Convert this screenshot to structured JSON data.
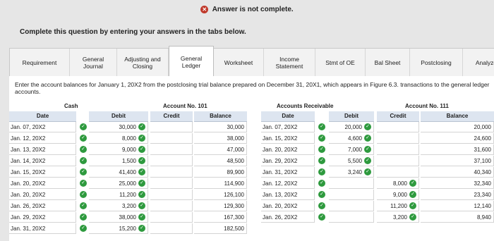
{
  "status": {
    "icon": "error-icon",
    "text": "Answer is not complete."
  },
  "instructions": "Complete this question by entering your answers in the tabs below.",
  "tabs": [
    {
      "label": "Requirement",
      "active": false
    },
    {
      "label": "General Journal",
      "active": false
    },
    {
      "label": "Adjusting and Closing",
      "active": false
    },
    {
      "label": "General Ledger",
      "active": true
    },
    {
      "label": "Worksheet",
      "active": false
    },
    {
      "label": "Income Statement",
      "active": false
    },
    {
      "label": "Stmt of OE",
      "active": false
    },
    {
      "label": "Bal Sheet",
      "active": false
    },
    {
      "label": "Postclosing",
      "active": false
    },
    {
      "label": "Analyze",
      "active": false
    }
  ],
  "prompt": "Enter the account balances for January 1, 20X2 from the postclosing trial balance prepared on December 31, 20X1, which appears in Figure 6.3. transactions to the general ledger accounts.",
  "ledgers": {
    "cash": {
      "title": "Cash",
      "account_no": "Account No. 101",
      "headers": {
        "date": "Date",
        "debit": "Debit",
        "credit": "Credit",
        "balance": "Balance"
      },
      "rows": [
        {
          "date": "Jan. 07, 20X2",
          "debit": "30,000",
          "credit": "",
          "balance": "30,000"
        },
        {
          "date": "Jan. 12, 20X2",
          "debit": "8,000",
          "credit": "",
          "balance": "38,000"
        },
        {
          "date": "Jan. 13, 20X2",
          "debit": "9,000",
          "credit": "",
          "balance": "47,000"
        },
        {
          "date": "Jan. 14, 20X2",
          "debit": "1,500",
          "credit": "",
          "balance": "48,500"
        },
        {
          "date": "Jan. 15, 20X2",
          "debit": "41,400",
          "credit": "",
          "balance": "89,900"
        },
        {
          "date": "Jan. 20, 20X2",
          "debit": "25,000",
          "credit": "",
          "balance": "114,900"
        },
        {
          "date": "Jan. 20, 20X2",
          "debit": "11,200",
          "credit": "",
          "balance": "126,100"
        },
        {
          "date": "Jan. 26, 20X2",
          "debit": "3,200",
          "credit": "",
          "balance": "129,300"
        },
        {
          "date": "Jan. 29, 20X2",
          "debit": "38,000",
          "credit": "",
          "balance": "167,300"
        },
        {
          "date": "Jan. 31, 20X2",
          "debit": "15,200",
          "credit": "",
          "balance": "182,500"
        }
      ]
    },
    "ar": {
      "title": "Accounts Receivable",
      "account_no": "Account No. 111",
      "headers": {
        "date": "Date",
        "debit": "Debit",
        "credit": "Credit",
        "balance": "Balance"
      },
      "rows": [
        {
          "date": "Jan. 07, 20X2",
          "debit": "20,000",
          "credit": "",
          "balance": "20,000"
        },
        {
          "date": "Jan. 15, 20X2",
          "debit": "4,600",
          "credit": "",
          "balance": "24,600"
        },
        {
          "date": "Jan. 20, 20X2",
          "debit": "7,000",
          "credit": "",
          "balance": "31,600"
        },
        {
          "date": "Jan. 29, 20X2",
          "debit": "5,500",
          "credit": "",
          "balance": "37,100"
        },
        {
          "date": "Jan. 31, 20X2",
          "debit": "3,240",
          "credit": "",
          "balance": "40,340"
        },
        {
          "date": "Jan. 12, 20X2",
          "debit": "",
          "credit": "8,000",
          "balance": "32,340"
        },
        {
          "date": "Jan. 13, 20X2",
          "debit": "",
          "credit": "9,000",
          "balance": "23,340"
        },
        {
          "date": "Jan. 20, 20X2",
          "debit": "",
          "credit": "11,200",
          "balance": "12,140"
        },
        {
          "date": "Jan. 26, 20X2",
          "debit": "",
          "credit": "3,200",
          "balance": "8,940"
        }
      ]
    }
  },
  "colors": {
    "check": "#2e9a3e",
    "error": "#c0392b",
    "header_bg": "#dde5f0"
  }
}
